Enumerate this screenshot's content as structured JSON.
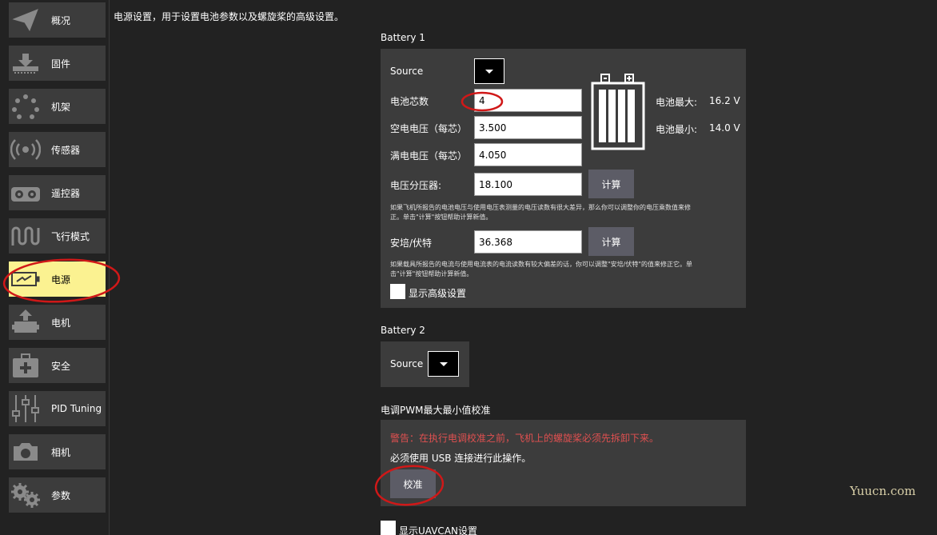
{
  "sidebar": {
    "items": [
      {
        "label": "概况",
        "icon": "paper-plane-icon"
      },
      {
        "label": "固件",
        "icon": "download-icon"
      },
      {
        "label": "机架",
        "icon": "frame-dots-icon"
      },
      {
        "label": "传感器",
        "icon": "radio-waves-icon"
      },
      {
        "label": "遥控器",
        "icon": "remote-control-icon"
      },
      {
        "label": "飞行模式",
        "icon": "wave-icon"
      },
      {
        "label": "电源",
        "icon": "battery-icon"
      },
      {
        "label": "电机",
        "icon": "motor-icon"
      },
      {
        "label": "安全",
        "icon": "first-aid-icon"
      },
      {
        "label": "PID Tuning",
        "icon": "sliders-icon"
      },
      {
        "label": "相机",
        "icon": "camera-icon"
      },
      {
        "label": "参数",
        "icon": "gears-icon"
      }
    ],
    "active_index": 6
  },
  "header": {
    "description": "电源设置，用于设置电池参数以及螺旋桨的高级设置。"
  },
  "battery1": {
    "title": "Battery 1",
    "source_label": "Source",
    "cells_label": "电池芯数",
    "cells_value": "4",
    "empty_label": "空电电压（每芯）",
    "empty_value": "3.500",
    "full_label": "满电电压（每芯）",
    "full_value": "4.050",
    "divider_label": "电压分压器:",
    "divider_value": "18.100",
    "calc_label": "计算",
    "divider_help_1": "如果飞机所报告的电池电压与使用电压表测量的电压读数有很大差异，那么你可以调整你的电压乘数值来修",
    "divider_help_2": "正。单击\"计算\"按钮帮助计算新值。",
    "amps_label": "安培/伏特",
    "amps_value": "36.368",
    "amps_help_1": "如果载具所报告的电流与使用电流表的电流读数有较大偏差的话，你可以调整\"安培/伏特\"的值来修正它。单",
    "amps_help_2": "击\"计算\"按钮帮助计算新值。",
    "advanced_label": "显示高级设置",
    "max_label": "电池最大:",
    "max_value": "16.2 V",
    "min_label": "电池最小:",
    "min_value": "14.0 V",
    "battery_icon": "battery-graphic-icon"
  },
  "battery2": {
    "title": "Battery 2",
    "source_label": "Source"
  },
  "esc": {
    "title": "电调PWM最大最小值校准",
    "warning": "警告：在执行电调校准之前，飞机上的螺旋桨必须先拆卸下来。",
    "usb_note": "必须使用 USB 连接进行此操作。",
    "calibrate_label": "校准"
  },
  "uavcan": {
    "label": "显示UAVCAN设置"
  },
  "watermark": "Yuucn.com",
  "colors": {
    "background": "#222222",
    "panel": "#3c3c3c",
    "active": "#fbf291",
    "button": "#5c5c66",
    "warning": "#e05050",
    "annotation": "#d01818"
  }
}
